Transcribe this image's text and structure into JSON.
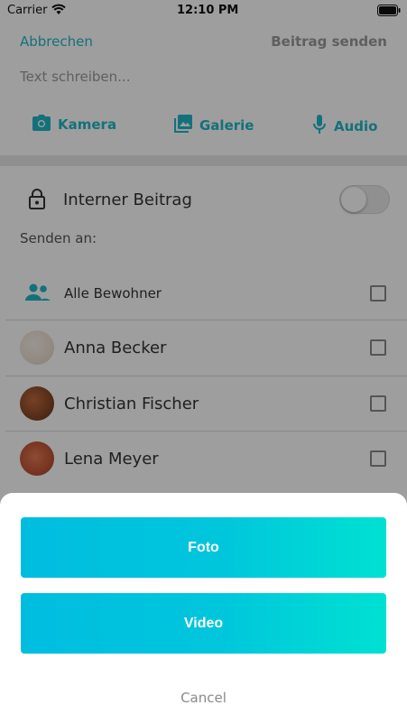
{
  "status_bar": {
    "carrier": "Carrier",
    "time": "12:10 PM"
  },
  "nav": {
    "cancel_label": "Abbrechen",
    "send_label": "Beitrag senden"
  },
  "compose": {
    "placeholder": "Text schreiben..."
  },
  "media": {
    "camera_label": "Kamera",
    "gallery_label": "Galerie",
    "audio_label": "Audio"
  },
  "internal": {
    "label": "Interner Beitrag",
    "enabled": false
  },
  "send_to": {
    "label": "Senden an:"
  },
  "recipients": [
    {
      "name": "Alle Bewohner",
      "checked": false
    },
    {
      "name": "Anna Becker",
      "checked": false
    },
    {
      "name": "Christian Fischer",
      "checked": false
    },
    {
      "name": "Lena Meyer",
      "checked": false
    }
  ],
  "sheet": {
    "foto_label": "Foto",
    "video_label": "Video",
    "cancel_label": "Cancel"
  },
  "colors": {
    "accent": "#1fb6c7",
    "gradient_start": "#00bde0",
    "gradient_end": "#00e1d2"
  }
}
